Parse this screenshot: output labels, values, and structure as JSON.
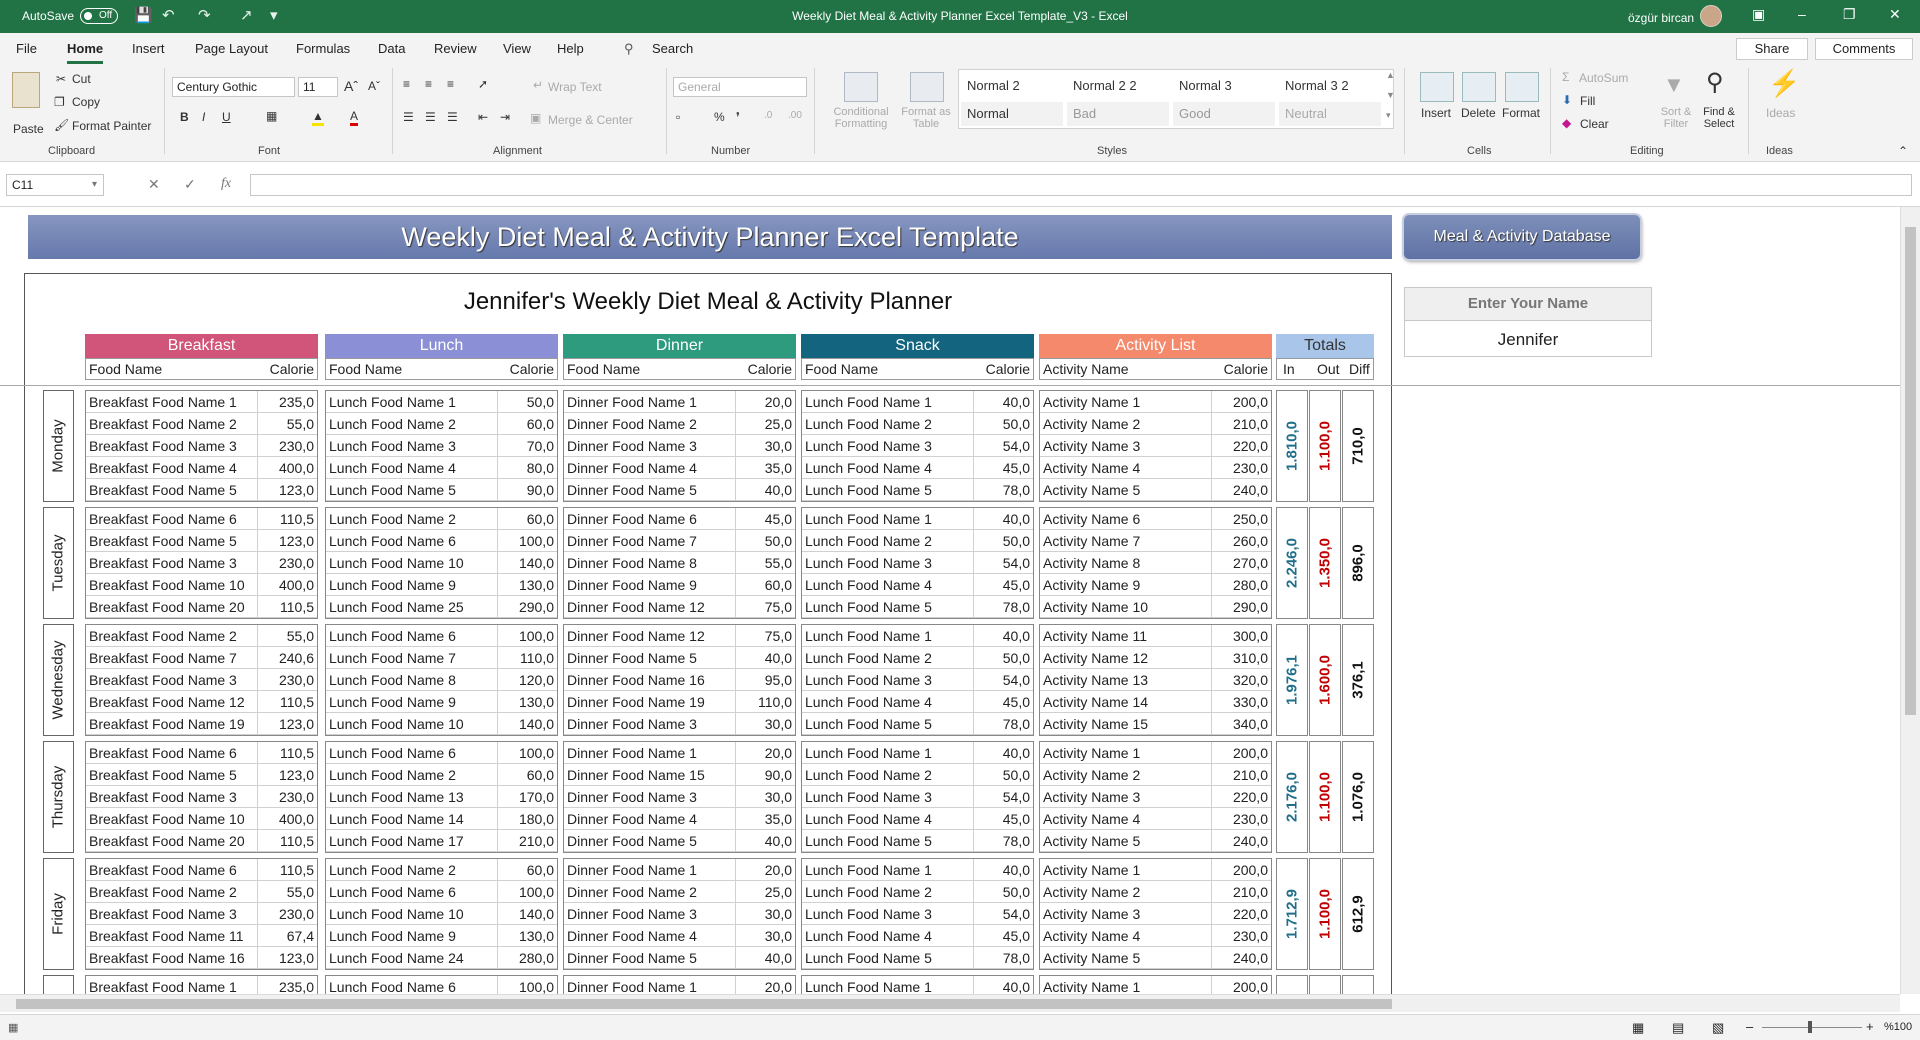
{
  "window": {
    "autosave_label": "AutoSave",
    "autosave_state": "Off",
    "title": "Weekly Diet Meal & Activity Planner Excel Template_V3  -  Excel",
    "user": "özgür bircan"
  },
  "menu": {
    "items": [
      "File",
      "Home",
      "Insert",
      "Page Layout",
      "Formulas",
      "Data",
      "Review",
      "View",
      "Help"
    ],
    "search": "Search",
    "share": "Share",
    "comments": "Comments"
  },
  "ribbon": {
    "clipboard": {
      "paste": "Paste",
      "cut": "Cut",
      "copy": "Copy",
      "format_painter": "Format Painter",
      "group": "Clipboard"
    },
    "font": {
      "name": "Century Gothic",
      "size": "11",
      "group": "Font"
    },
    "alignment": {
      "wrap": "Wrap Text",
      "merge": "Merge & Center",
      "group": "Alignment"
    },
    "number": {
      "format": "General",
      "group": "Number"
    },
    "styles": {
      "conditional": "Conditional Formatting",
      "format_table": "Format as Table",
      "group": "Styles",
      "cells": [
        "Normal 2",
        "Normal 2 2",
        "Normal 3",
        "Normal 3 2",
        "Normal",
        "Bad",
        "Good",
        "Neutral"
      ]
    },
    "cells": {
      "insert": "Insert",
      "delete": "Delete",
      "format": "Format",
      "group": "Cells"
    },
    "editing": {
      "autosum": "AutoSum",
      "fill": "Fill",
      "clear": "Clear",
      "sort": "Sort & Filter",
      "find": "Find & Select",
      "group": "Editing"
    },
    "ideas": {
      "label": "Ideas",
      "group": "Ideas"
    }
  },
  "formula_bar": {
    "cell": "C11",
    "value": ""
  },
  "sheet": {
    "banner": "Weekly Diet Meal & Activity Planner Excel Template",
    "db_button": "Meal & Activity Database",
    "planner_title": "Jennifer's Weekly Diet Meal & Activity Planner",
    "name_label": "Enter Your Name",
    "name_value": "Jennifer",
    "categories": [
      {
        "title": "Breakfast",
        "col": "Food Name",
        "cal": "Calorie",
        "color": "#d1547a"
      },
      {
        "title": "Lunch",
        "col": "Food Name",
        "cal": "Calorie",
        "color": "#8b8fd6"
      },
      {
        "title": "Dinner",
        "col": "Food Name",
        "cal": "Calorie",
        "color": "#2e9b7f"
      },
      {
        "title": "Snack",
        "col": "Food Name",
        "cal": "Calorie",
        "color": "#13657f"
      },
      {
        "title": "Activity List",
        "col": "Activity Name",
        "cal": "Calorie",
        "color": "#f4896c"
      }
    ],
    "totals": {
      "title": "Totals",
      "in": "In",
      "out": "Out",
      "diff": "Diff",
      "color": "#8ab0dd"
    },
    "days": [
      {
        "name": "Monday",
        "in": "1.810,0",
        "out": "1.100,0",
        "diff": "710,0",
        "rows": [
          [
            [
              "Breakfast Food Name 1",
              "235,0"
            ],
            [
              "Lunch Food Name 1",
              "50,0"
            ],
            [
              "Dinner Food Name 1",
              "20,0"
            ],
            [
              "Lunch Food Name 1",
              "40,0"
            ],
            [
              "Activity Name 1",
              "200,0"
            ]
          ],
          [
            [
              "Breakfast Food Name 2",
              "55,0"
            ],
            [
              "Lunch Food Name 2",
              "60,0"
            ],
            [
              "Dinner Food Name 2",
              "25,0"
            ],
            [
              "Lunch Food Name 2",
              "50,0"
            ],
            [
              "Activity Name 2",
              "210,0"
            ]
          ],
          [
            [
              "Breakfast Food Name 3",
              "230,0"
            ],
            [
              "Lunch Food Name 3",
              "70,0"
            ],
            [
              "Dinner Food Name 3",
              "30,0"
            ],
            [
              "Lunch Food Name 3",
              "54,0"
            ],
            [
              "Activity Name 3",
              "220,0"
            ]
          ],
          [
            [
              "Breakfast Food Name 4",
              "400,0"
            ],
            [
              "Lunch Food Name 4",
              "80,0"
            ],
            [
              "Dinner Food Name 4",
              "35,0"
            ],
            [
              "Lunch Food Name 4",
              "45,0"
            ],
            [
              "Activity Name 4",
              "230,0"
            ]
          ],
          [
            [
              "Breakfast Food Name 5",
              "123,0"
            ],
            [
              "Lunch Food Name 5",
              "90,0"
            ],
            [
              "Dinner Food Name 5",
              "40,0"
            ],
            [
              "Lunch Food Name 5",
              "78,0"
            ],
            [
              "Activity Name 5",
              "240,0"
            ]
          ]
        ]
      },
      {
        "name": "Tuesday",
        "in": "2.246,0",
        "out": "1.350,0",
        "diff": "896,0",
        "rows": [
          [
            [
              "Breakfast Food Name 6",
              "110,5"
            ],
            [
              "Lunch Food Name 2",
              "60,0"
            ],
            [
              "Dinner Food Name 6",
              "45,0"
            ],
            [
              "Lunch Food Name 1",
              "40,0"
            ],
            [
              "Activity Name 6",
              "250,0"
            ]
          ],
          [
            [
              "Breakfast Food Name 5",
              "123,0"
            ],
            [
              "Lunch Food Name 6",
              "100,0"
            ],
            [
              "Dinner Food Name 7",
              "50,0"
            ],
            [
              "Lunch Food Name 2",
              "50,0"
            ],
            [
              "Activity Name 7",
              "260,0"
            ]
          ],
          [
            [
              "Breakfast Food Name 3",
              "230,0"
            ],
            [
              "Lunch Food Name 10",
              "140,0"
            ],
            [
              "Dinner Food Name 8",
              "55,0"
            ],
            [
              "Lunch Food Name 3",
              "54,0"
            ],
            [
              "Activity Name 8",
              "270,0"
            ]
          ],
          [
            [
              "Breakfast Food Name 10",
              "400,0"
            ],
            [
              "Lunch Food Name 9",
              "130,0"
            ],
            [
              "Dinner Food Name 9",
              "60,0"
            ],
            [
              "Lunch Food Name 4",
              "45,0"
            ],
            [
              "Activity Name 9",
              "280,0"
            ]
          ],
          [
            [
              "Breakfast Food Name 20",
              "110,5"
            ],
            [
              "Lunch Food Name 25",
              "290,0"
            ],
            [
              "Dinner Food Name 12",
              "75,0"
            ],
            [
              "Lunch Food Name 5",
              "78,0"
            ],
            [
              "Activity Name 10",
              "290,0"
            ]
          ]
        ]
      },
      {
        "name": "Wednesday",
        "in": "1.976,1",
        "out": "1.600,0",
        "diff": "376,1",
        "rows": [
          [
            [
              "Breakfast Food Name 2",
              "55,0"
            ],
            [
              "Lunch Food Name 6",
              "100,0"
            ],
            [
              "Dinner Food Name 12",
              "75,0"
            ],
            [
              "Lunch Food Name 1",
              "40,0"
            ],
            [
              "Activity Name 11",
              "300,0"
            ]
          ],
          [
            [
              "Breakfast Food Name 7",
              "240,6"
            ],
            [
              "Lunch Food Name 7",
              "110,0"
            ],
            [
              "Dinner Food Name 5",
              "40,0"
            ],
            [
              "Lunch Food Name 2",
              "50,0"
            ],
            [
              "Activity Name 12",
              "310,0"
            ]
          ],
          [
            [
              "Breakfast Food Name 3",
              "230,0"
            ],
            [
              "Lunch Food Name 8",
              "120,0"
            ],
            [
              "Dinner Food Name 16",
              "95,0"
            ],
            [
              "Lunch Food Name 3",
              "54,0"
            ],
            [
              "Activity Name 13",
              "320,0"
            ]
          ],
          [
            [
              "Breakfast Food Name 12",
              "110,5"
            ],
            [
              "Lunch Food Name 9",
              "130,0"
            ],
            [
              "Dinner Food Name 19",
              "110,0"
            ],
            [
              "Lunch Food Name 4",
              "45,0"
            ],
            [
              "Activity Name 14",
              "330,0"
            ]
          ],
          [
            [
              "Breakfast Food Name 19",
              "123,0"
            ],
            [
              "Lunch Food Name 10",
              "140,0"
            ],
            [
              "Dinner Food Name 3",
              "30,0"
            ],
            [
              "Lunch Food Name 5",
              "78,0"
            ],
            [
              "Activity Name 15",
              "340,0"
            ]
          ]
        ]
      },
      {
        "name": "Thursday",
        "in": "2.176,0",
        "out": "1.100,0",
        "diff": "1.076,0",
        "rows": [
          [
            [
              "Breakfast Food Name 6",
              "110,5"
            ],
            [
              "Lunch Food Name 6",
              "100,0"
            ],
            [
              "Dinner Food Name 1",
              "20,0"
            ],
            [
              "Lunch Food Name 1",
              "40,0"
            ],
            [
              "Activity Name 1",
              "200,0"
            ]
          ],
          [
            [
              "Breakfast Food Name 5",
              "123,0"
            ],
            [
              "Lunch Food Name 2",
              "60,0"
            ],
            [
              "Dinner Food Name 15",
              "90,0"
            ],
            [
              "Lunch Food Name 2",
              "50,0"
            ],
            [
              "Activity Name 2",
              "210,0"
            ]
          ],
          [
            [
              "Breakfast Food Name 3",
              "230,0"
            ],
            [
              "Lunch Food Name 13",
              "170,0"
            ],
            [
              "Dinner Food Name 3",
              "30,0"
            ],
            [
              "Lunch Food Name 3",
              "54,0"
            ],
            [
              "Activity Name 3",
              "220,0"
            ]
          ],
          [
            [
              "Breakfast Food Name 10",
              "400,0"
            ],
            [
              "Lunch Food Name 14",
              "180,0"
            ],
            [
              "Dinner Food Name 4",
              "35,0"
            ],
            [
              "Lunch Food Name 4",
              "45,0"
            ],
            [
              "Activity Name 4",
              "230,0"
            ]
          ],
          [
            [
              "Breakfast Food Name 20",
              "110,5"
            ],
            [
              "Lunch Food Name 17",
              "210,0"
            ],
            [
              "Dinner Food Name 5",
              "40,0"
            ],
            [
              "Lunch Food Name 5",
              "78,0"
            ],
            [
              "Activity Name 5",
              "240,0"
            ]
          ]
        ]
      },
      {
        "name": "Friday",
        "in": "1.712,9",
        "out": "1.100,0",
        "diff": "612,9",
        "rows": [
          [
            [
              "Breakfast Food Name 6",
              "110,5"
            ],
            [
              "Lunch Food Name 2",
              "60,0"
            ],
            [
              "Dinner Food Name 1",
              "20,0"
            ],
            [
              "Lunch Food Name 1",
              "40,0"
            ],
            [
              "Activity Name 1",
              "200,0"
            ]
          ],
          [
            [
              "Breakfast Food Name 2",
              "55,0"
            ],
            [
              "Lunch Food Name 6",
              "100,0"
            ],
            [
              "Dinner Food Name 2",
              "25,0"
            ],
            [
              "Lunch Food Name 2",
              "50,0"
            ],
            [
              "Activity Name 2",
              "210,0"
            ]
          ],
          [
            [
              "Breakfast Food Name 3",
              "230,0"
            ],
            [
              "Lunch Food Name 10",
              "140,0"
            ],
            [
              "Dinner Food Name 3",
              "30,0"
            ],
            [
              "Lunch Food Name 3",
              "54,0"
            ],
            [
              "Activity Name 3",
              "220,0"
            ]
          ],
          [
            [
              "Breakfast Food Name 11",
              "67,4"
            ],
            [
              "Lunch Food Name 9",
              "130,0"
            ],
            [
              "Dinner Food Name 4",
              "30,0"
            ],
            [
              "Lunch Food Name 4",
              "45,0"
            ],
            [
              "Activity Name 4",
              "230,0"
            ]
          ],
          [
            [
              "Breakfast Food Name 16",
              "123,0"
            ],
            [
              "Lunch Food Name 24",
              "280,0"
            ],
            [
              "Dinner Food Name 5",
              "40,0"
            ],
            [
              "Lunch Food Name 5",
              "78,0"
            ],
            [
              "Activity Name 5",
              "240,0"
            ]
          ]
        ]
      },
      {
        "name": "",
        "in": "",
        "out": "",
        "diff": "",
        "rows": [
          [
            [
              "Breakfast Food Name 1",
              "235,0"
            ],
            [
              "Lunch Food Name 6",
              "100,0"
            ],
            [
              "Dinner Food Name 1",
              "20,0"
            ],
            [
              "Lunch Food Name 1",
              "40,0"
            ],
            [
              "Activity Name 1",
              "200,0"
            ]
          ]
        ]
      }
    ]
  },
  "status": {
    "zoom": "%100"
  }
}
